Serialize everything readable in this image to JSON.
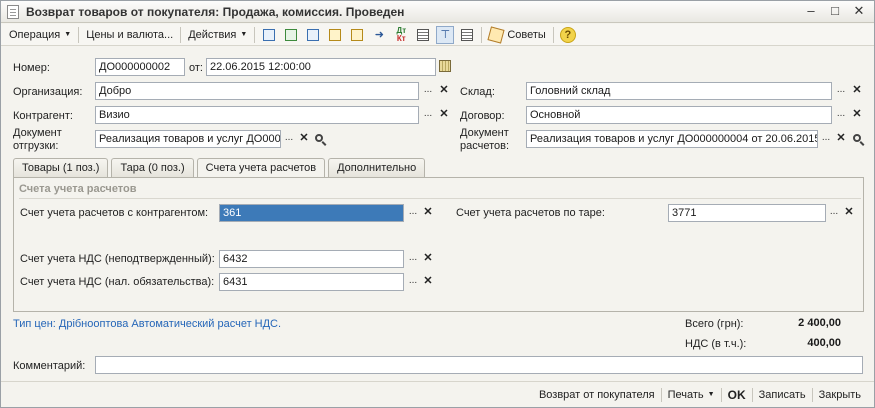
{
  "window": {
    "title": "Возврат товаров от покупателя: Продажа, комиссия. Проведен",
    "buttons": [
      "–",
      "□",
      "✕"
    ]
  },
  "toolbar": {
    "operation": "Операция",
    "prices": "Цены и валюта...",
    "actions": "Действия",
    "tips": "Советы",
    "dtkt_top": "Дт",
    "dtkt_bottom": "Кт",
    "help": "?"
  },
  "header": {
    "number_label": "Номер:",
    "number_value": "ДО000000002",
    "from_label": "от:",
    "date_value": "22.06.2015 12:00:00",
    "org_label": "Организация:",
    "org_value": "Добро",
    "warehouse_label": "Склад:",
    "warehouse_value": "Головний склад",
    "contractor_label": "Контрагент:",
    "contractor_value": "Визио",
    "contract_label": "Договор:",
    "contract_value": "Основной",
    "shipdoc_label_1": "Документ",
    "shipdoc_label_2": "отгрузки:",
    "shipdoc_value": "Реализация товаров и услуг ДО000",
    "settledoc_label_1": "Документ",
    "settledoc_label_2": "расчетов:",
    "settledoc_value": "Реализация товаров и услуг ДО000000004 от 20.06.2015"
  },
  "tabs": [
    {
      "label": "Товары (1 поз.)"
    },
    {
      "label": "Тара (0 поз.)"
    },
    {
      "label": "Счета учета расчетов"
    },
    {
      "label": "Дополнительно"
    }
  ],
  "accounts": {
    "group_title": "Счета учета расчетов",
    "contractor_label": "Счет учета расчетов с контрагентом:",
    "contractor_value": "361",
    "tare_label": "Счет учета расчетов по таре:",
    "tare_value": "3771",
    "vat_unconfirmed_label": "Счет учета НДС (неподтвержденный):",
    "vat_unconfirmed_value": "6432",
    "vat_liability_label": "Счет учета НДС (нал. обязательства):",
    "vat_liability_value": "6431"
  },
  "footer": {
    "price_type": "Тип цен: Дрібнооптова Автоматический расчет НДС.",
    "total_label": "Всего (грн):",
    "total_value": "2 400,00",
    "vat_label": "НДС (в т.ч.):",
    "vat_value": "400,00",
    "comment_label": "Комментарий:",
    "comment_value": ""
  },
  "bottom": {
    "return": "Возврат от покупателя",
    "print": "Печать",
    "ok": "OK",
    "save": "Записать",
    "close": "Закрыть"
  }
}
